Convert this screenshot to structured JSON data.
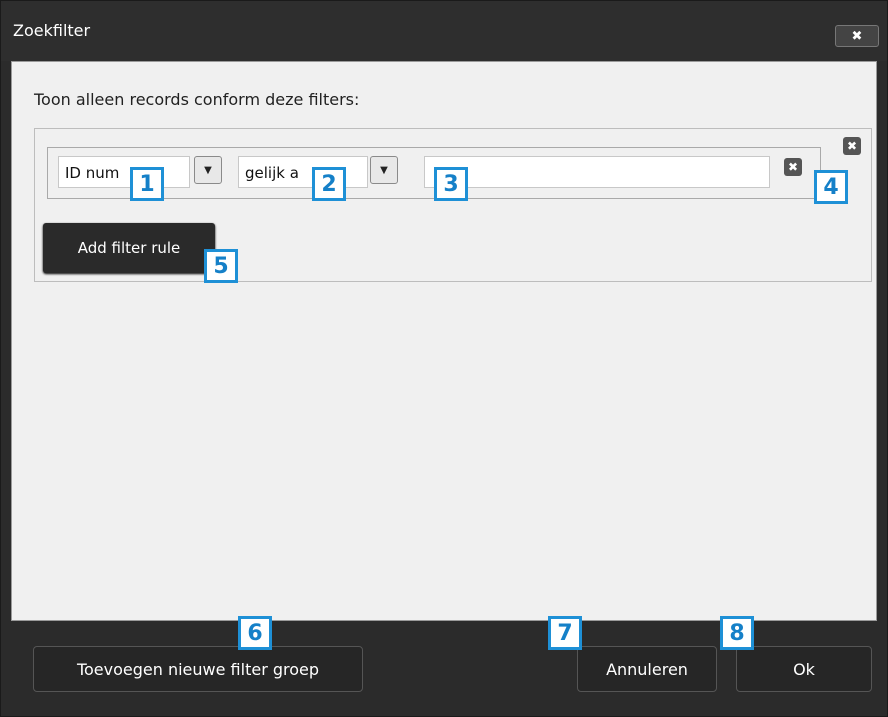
{
  "dialog": {
    "title": "Zoekfilter",
    "close_icon": "close-icon",
    "close_label": "✖"
  },
  "content": {
    "instruction": "Toon alleen records conform deze filters:"
  },
  "filter_rule": {
    "field_value": "ID num",
    "operator_value": "gelijk a",
    "value_text": "",
    "dropdown_arrow": "▼",
    "remove_label": "✖"
  },
  "group": {
    "remove_label": "✖",
    "add_rule_label": "Add filter rule"
  },
  "footer": {
    "add_group_label": "Toevoegen nieuwe filter groep",
    "cancel_label": "Annuleren",
    "ok_label": "Ok"
  },
  "callouts": [
    "1",
    "2",
    "3",
    "4",
    "5",
    "6",
    "7",
    "8"
  ],
  "colors": {
    "callout_border": "#1e90d6",
    "dark_chrome": "#2b2b2b",
    "panel_bg": "#f0f0f0"
  }
}
